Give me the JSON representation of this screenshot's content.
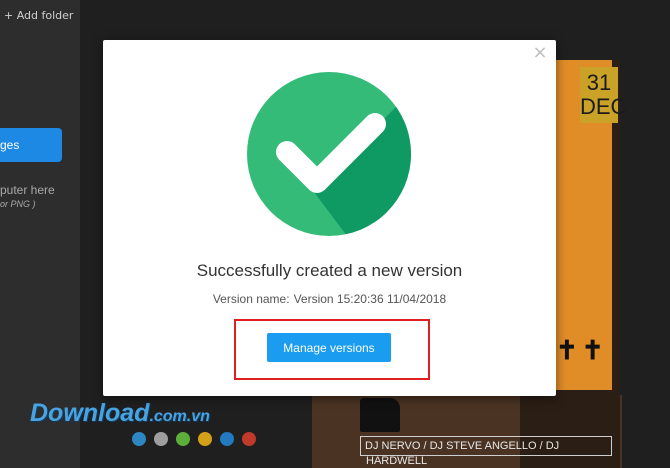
{
  "sidebar": {
    "add_folder_label": "+ Add folder",
    "upload_button_label": "ges",
    "drop_text": "puter here",
    "drop_subtext": "or PNG )"
  },
  "poster": {
    "date_day": "31",
    "date_month": "DEC",
    "lineup_text": "DJ NERVO / DJ STEVE ANGELLO / DJ",
    "lineup_text_2": "HARDWELL"
  },
  "watermark": {
    "brand": "Download",
    "domain": ".com.vn"
  },
  "swatches": [
    "#2e86c1",
    "#9e9e9e",
    "#5cae3b",
    "#d4a017",
    "#2279c0",
    "#c0392b"
  ],
  "modal": {
    "title": "Successfully created a new version",
    "version_label": "Version name:",
    "version_value": "Version 15:20:36 11/04/2018",
    "manage_button_label": "Manage versions",
    "close_symbol": "×",
    "success_color": "#34bb78"
  }
}
